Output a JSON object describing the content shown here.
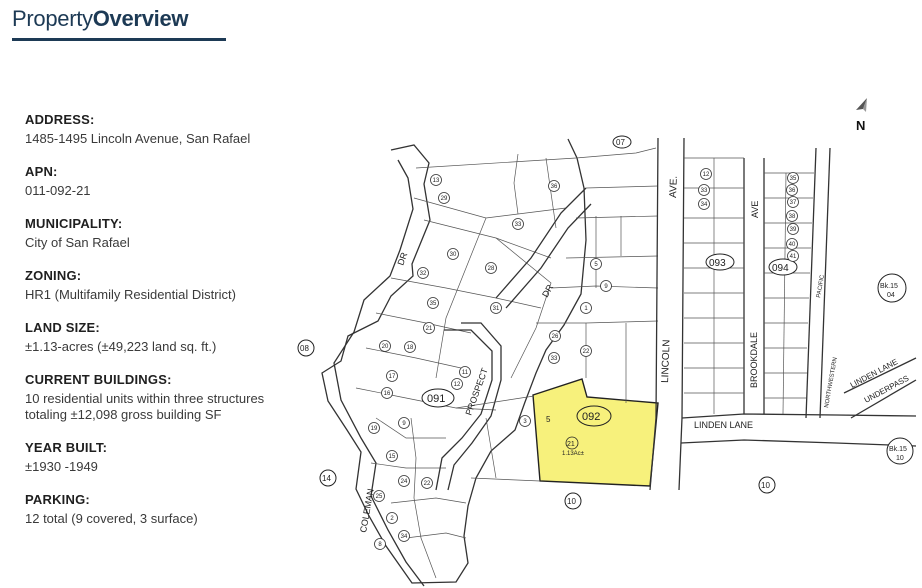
{
  "header": {
    "title_light": "Property",
    "title_bold": "Overview"
  },
  "fields": [
    {
      "label": "ADDRESS:",
      "value": "1485-1495 Lincoln Avenue, San Rafael"
    },
    {
      "label": "APN:",
      "value": "011-092-21"
    },
    {
      "label": "MUNICIPALITY:",
      "value": "City of San Rafael"
    },
    {
      "label": "ZONING:",
      "value": "HR1 (Multifamily Residential District)"
    },
    {
      "label": "LAND SIZE:",
      "value": "±1.13-acres (±49,223 land sq. ft.)"
    },
    {
      "label": "CURRENT BUILDINGS:",
      "value": "10 residential units within three structures\ntotaling ±12,098 gross building SF"
    },
    {
      "label": "YEAR BUILT:",
      "value": "±1930 -1949"
    },
    {
      "label": "PARKING:",
      "value": "12 total (9 covered, 3 surface)"
    }
  ],
  "map": {
    "north_label": "N",
    "highlight_color": "#f7f17c",
    "streets": {
      "lincoln_ave": "LINCOLN",
      "ave": "AVE.",
      "linden_lane": "LINDEN LANE",
      "brookdale": "BROOKDALE",
      "brookdale_ave": "AVE",
      "prospect": "PROSPECT",
      "coleman": "COLEMAN",
      "dr": "DR",
      "dr2": "DR",
      "linden_underpass_1": "LINDEN LANE",
      "linden_underpass_2": "UNDERPASS",
      "northwestern": "NORTHWESTERN",
      "pacific": "PACIFIC"
    },
    "block_numbers": {
      "b091": "091",
      "b092": "092",
      "b093": "093",
      "b094": "094",
      "b07": "07",
      "b08": "08",
      "b10a": "10",
      "b10b": "10",
      "b14": "14"
    },
    "book_refs": {
      "bk15_04_a": "Bk.15",
      "bk15_04_b": "04",
      "bk15_10_a": "Bk.15",
      "bk15_10_b": "10"
    },
    "subject": {
      "parcel": "21",
      "lot": "5",
      "acres": "1.13Ac±"
    },
    "parcels": [
      "13",
      "29",
      "33",
      "36",
      "28",
      "31",
      "30",
      "32",
      "35",
      "21",
      "20",
      "18",
      "17",
      "16",
      "19",
      "9",
      "15",
      "25",
      "24",
      "22",
      "2",
      "34",
      "8",
      "11",
      "12",
      "33",
      "22",
      "26",
      "1",
      "3",
      "9",
      "5",
      "12",
      "33",
      "34",
      "35",
      "36",
      "37",
      "38",
      "39",
      "40",
      "41"
    ]
  }
}
